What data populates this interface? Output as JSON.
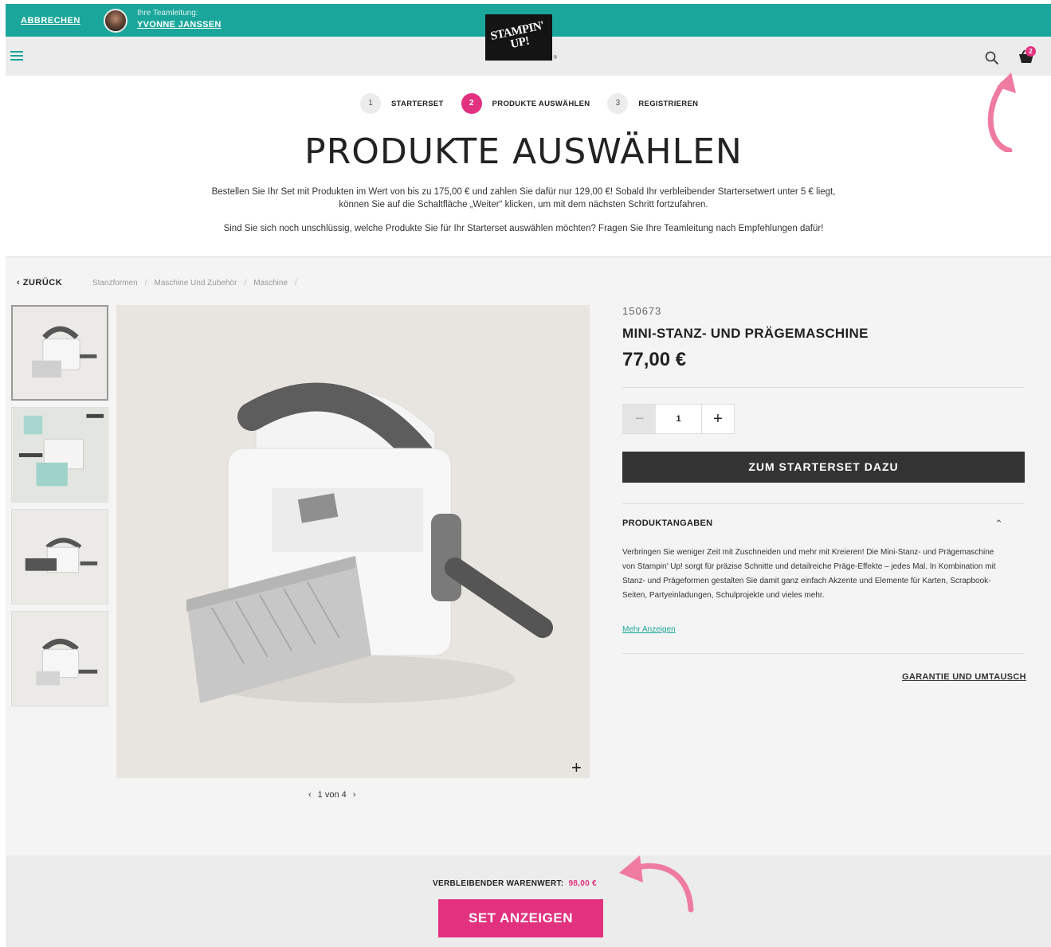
{
  "topbar": {
    "cancel_label": "ABBRECHEN",
    "lead_caption": "Ihre Teamleitung:",
    "lead_name": "YVONNE JANSSEN"
  },
  "header": {
    "logo_text": "STAMPIN' UP!",
    "cart_count": "2"
  },
  "steps": [
    {
      "num": "1",
      "label": "STARTERSET"
    },
    {
      "num": "2",
      "label": "PRODUKTE AUSWÄHLEN"
    },
    {
      "num": "3",
      "label": "REGISTRIEREN"
    }
  ],
  "page": {
    "title": "PRODUKTE AUSWÄHLEN",
    "intro_line1": "Bestellen Sie Ihr Set mit Produkten im Wert von bis zu 175,00 € und zahlen Sie dafür nur 129,00 €! Sobald Ihr verbleibender Startersetwert unter 5 € liegt,",
    "intro_line2": "können Sie auf die Schaltfläche „Weiter“ klicken, um mit dem nächsten Schritt fortzufahren.",
    "intro_question": "Sind Sie sich noch unschlüssig, welche Produkte Sie für Ihr Starterset auswählen möchten? Fragen Sie Ihre Teamleitung nach Empfehlungen dafür!"
  },
  "breadcrumb": {
    "back_label": "ZURÜCK",
    "items": [
      "Stanzformen",
      "Maschine Und Zubehör",
      "Maschine"
    ]
  },
  "gallery": {
    "pager_text": "1 von 4"
  },
  "product": {
    "sku": "150673",
    "name": "MINI-STANZ- UND PRÄGEMASCHINE",
    "price": "77,00 €",
    "quantity": "1",
    "add_label": "ZUM STARTERSET DAZU",
    "details_heading": "PRODUKTANGABEN",
    "details_text": "Verbringen Sie weniger Zeit mit Zuschneiden und mehr mit Kreieren! Die Mini-Stanz- und Prägemaschine von Stampin’ Up! sorgt für präzise Schnitte und detailreiche Präge-Effekte – jedes Mal. In Kombination mit Stanz- und Prägeformen gestalten Sie damit ganz einfach Akzente und Elemente für Karten, Scrapbook-Seiten, Partyeinladungen, Schulprojekte und vieles mehr.",
    "more_label": "Mehr Anzeigen",
    "warranty_label": "GARANTIE UND UMTAUSCH"
  },
  "footer": {
    "remaining_label": "VERBLEIBENDER WARENWERT:",
    "remaining_value": "98,00 €",
    "set_button_label": "SET ANZEIGEN"
  },
  "colors": {
    "teal": "#1aa69a",
    "pink": "#e2327f",
    "dark_button": "#333333"
  }
}
